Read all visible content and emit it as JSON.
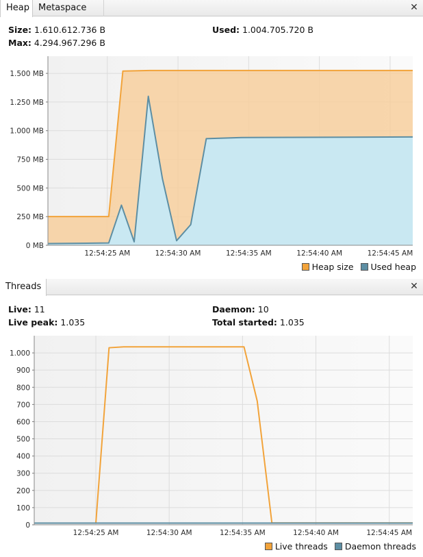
{
  "heap": {
    "tabs": [
      "Heap",
      "Metaspace"
    ],
    "size_label": "Size:",
    "size_value": "1.610.612.736 B",
    "used_label": "Used:",
    "used_value": "1.004.705.720 B",
    "max_label": "Max:",
    "max_value": "4.294.967.296 B",
    "close_icon": "close-icon",
    "legend": [
      {
        "label": "Heap size",
        "color": "#f2a33a"
      },
      {
        "label": "Used heap",
        "color": "#5d8ea3"
      }
    ]
  },
  "threads": {
    "title": "Threads",
    "live_label": "Live:",
    "live_value": "11",
    "daemon_label": "Daemon:",
    "daemon_value": "10",
    "peak_label": "Live peak:",
    "peak_value": "1.035",
    "started_label": "Total started:",
    "started_value": "1.035",
    "close_icon": "close-icon",
    "legend": [
      {
        "label": "Live threads",
        "color": "#f2a33a"
      },
      {
        "label": "Daemon threads",
        "color": "#5d8ea3"
      }
    ]
  },
  "chart_data": [
    {
      "type": "area",
      "y_ticks": [
        "0 MB",
        "250 MB",
        "500 MB",
        "750 MB",
        "1.000 MB",
        "1.250 MB",
        "1.500 MB"
      ],
      "y_tick_values": [
        0,
        250,
        500,
        750,
        1000,
        1250,
        1500
      ],
      "ylim": [
        0,
        1650
      ],
      "x_ticks": [
        "12:54:25 AM",
        "12:54:30 AM",
        "12:54:35 AM",
        "12:54:40 AM",
        "12:54:45 AM"
      ],
      "x_tick_values": [
        25,
        30,
        35,
        40,
        45
      ],
      "xlim": [
        20.8,
        46.6
      ],
      "grid": true,
      "legend_position": "bottom-right",
      "series": [
        {
          "name": "Heap size",
          "color": "#f2a33a",
          "x": [
            20.8,
            25.1,
            26.1,
            28,
            34,
            46.6
          ],
          "y": [
            250,
            250,
            1520,
            1525,
            1525,
            1525
          ]
        },
        {
          "name": "Used heap",
          "color": "#5d8ea3",
          "x": [
            20.8,
            25.1,
            26.0,
            26.9,
            27.9,
            28.9,
            29.9,
            30.9,
            32.0,
            34.5,
            46.6
          ],
          "y": [
            15,
            20,
            350,
            30,
            1300,
            580,
            40,
            180,
            930,
            940,
            945
          ]
        }
      ]
    },
    {
      "type": "line",
      "y_ticks": [
        "0",
        "100",
        "200",
        "300",
        "400",
        "500",
        "600",
        "700",
        "800",
        "900",
        "1.000"
      ],
      "y_tick_values": [
        0,
        100,
        200,
        300,
        400,
        500,
        600,
        700,
        800,
        900,
        1000
      ],
      "ylim": [
        0,
        1100
      ],
      "x_ticks": [
        "12:54:25 AM",
        "12:54:30 AM",
        "12:54:35 AM",
        "12:54:40 AM",
        "12:54:45 AM"
      ],
      "x_tick_values": [
        25,
        30,
        35,
        40,
        45
      ],
      "xlim": [
        20.8,
        46.6
      ],
      "grid": true,
      "legend_position": "bottom-right",
      "series": [
        {
          "name": "Live threads",
          "color": "#f2a33a",
          "x": [
            20.8,
            25.0,
            25.9,
            26.9,
            35.1,
            36.0,
            37.0,
            46.6
          ],
          "y": [
            10,
            10,
            1030,
            1035,
            1035,
            720,
            11,
            11
          ]
        },
        {
          "name": "Daemon threads",
          "color": "#5d8ea3",
          "x": [
            20.8,
            46.6
          ],
          "y": [
            10,
            10
          ]
        }
      ]
    }
  ]
}
